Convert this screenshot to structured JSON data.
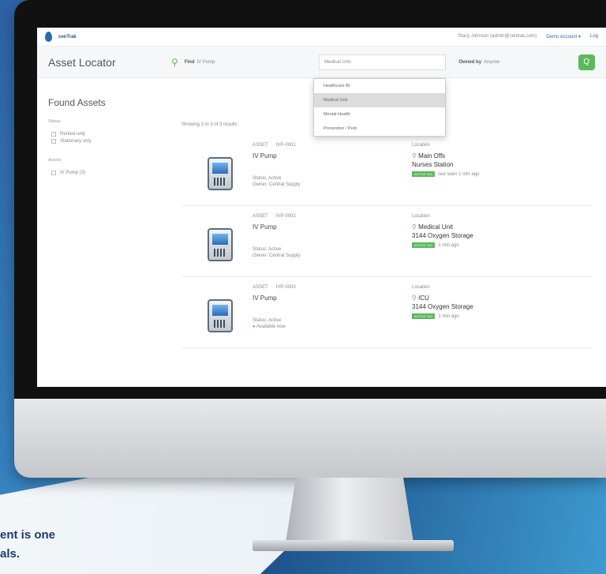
{
  "topbar": {
    "brand": "cenTrak",
    "user": "Stacy Johnson (admin@centrak.com)",
    "account": "Demo Account ▾",
    "logout": "Log"
  },
  "searchbar": {
    "app_name": "Asset Locator",
    "find_label": "Find",
    "find_value": "IV Pump",
    "location_value": "Medical Unit",
    "owned_label": "Owned by",
    "owned_value": "Anyone",
    "go": "Q"
  },
  "dropdown": {
    "items": [
      "Healthcare Bt",
      "Medical Unit",
      "Mental Health",
      "Prevention / Pedi"
    ],
    "selected_index": 1
  },
  "left": {
    "title": "Found Assets",
    "status_head": "Status",
    "status_options": [
      "Rented only",
      "Stationary only"
    ],
    "assets_head": "Assets",
    "asset_options": [
      "IV Pump (3)"
    ]
  },
  "results": {
    "showing": "Showing 3 to 3 of 3 results",
    "items": [
      {
        "id1": "ASSET",
        "id2": "IVP-0001",
        "name": "IV Pump",
        "sub1": "Status: Active",
        "sub2": "Owner: Central Supply",
        "loc_label": "Location",
        "loc1": "Main Offs",
        "loc2": "Nurses Station",
        "badge": "ACTIVE TAG",
        "badge_note": "last seen 1 min ago"
      },
      {
        "id1": "ASSET",
        "id2": "IVP-0002",
        "name": "IV Pump",
        "sub1": "Status: Active",
        "sub2": "Owner: Central Supply",
        "loc_label": "Location",
        "loc1": "Medical Unit",
        "loc2": "3144 Oxygen Storage",
        "badge": "ACTIVE TAG",
        "badge_note": "1 min ago"
      },
      {
        "id1": "ASSET",
        "id2": "IVP-0003",
        "name": "IV Pump",
        "sub1": "Status: Active",
        "sub2": "Available now",
        "loc_label": "Location",
        "loc1": "ICU",
        "loc2": "3144 Oxygen Storage",
        "badge": "ACTIVE TAG",
        "badge_note": "1 min ago"
      }
    ]
  },
  "tagline": {
    "line1": "ent is one",
    "line2": "als."
  }
}
